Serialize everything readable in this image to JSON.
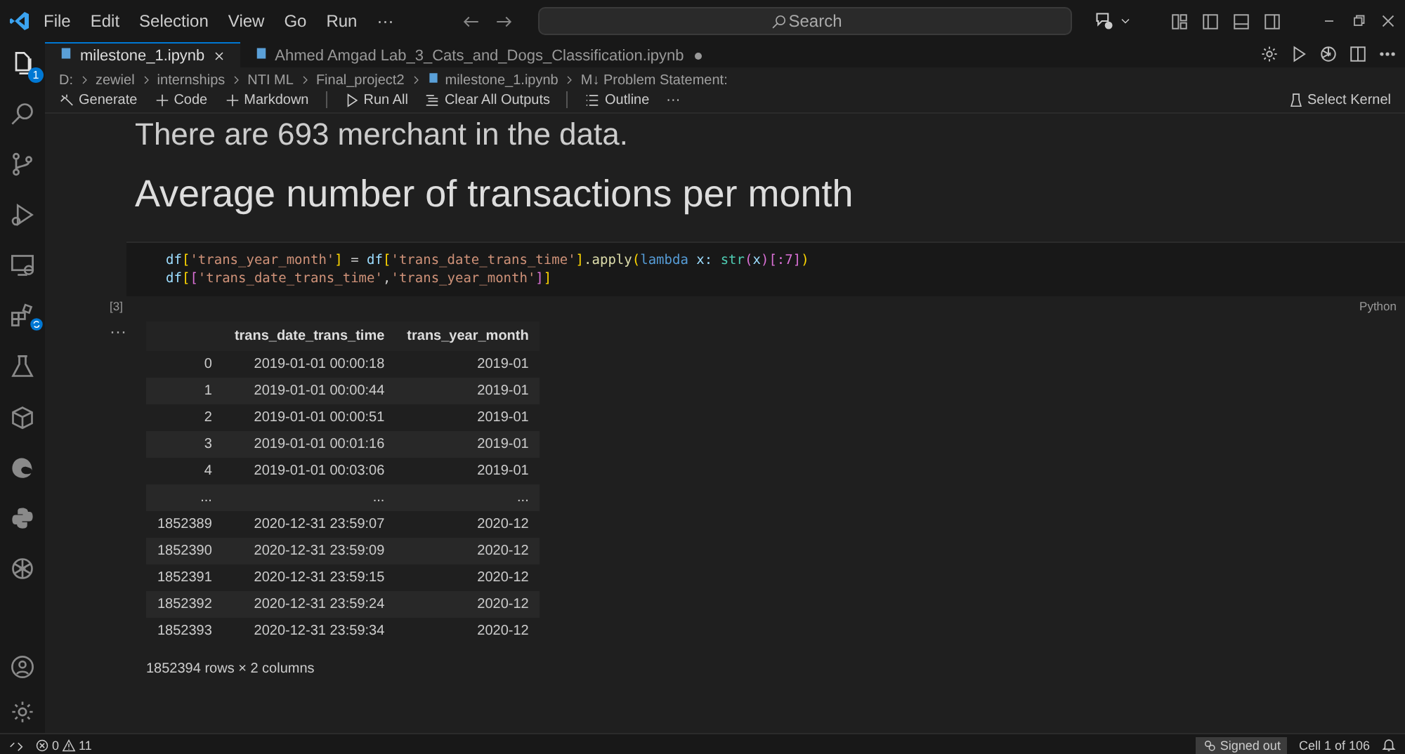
{
  "menu": [
    "File",
    "Edit",
    "Selection",
    "View",
    "Go",
    "Run",
    "···"
  ],
  "search": {
    "placeholder": "Search"
  },
  "activity_bar": {
    "items": [
      {
        "kind": "files",
        "selected": true,
        "badge": "1"
      },
      {
        "kind": "search",
        "selected": false
      },
      {
        "kind": "branch",
        "selected": false
      },
      {
        "kind": "debug",
        "selected": false
      },
      {
        "kind": "remote",
        "selected": false
      },
      {
        "kind": "extensions",
        "selected": false
      },
      {
        "kind": "flask",
        "selected": false
      },
      {
        "kind": "box",
        "selected": false
      },
      {
        "kind": "edge",
        "selected": false
      },
      {
        "kind": "python",
        "selected": false
      },
      {
        "kind": "openai",
        "selected": false
      }
    ]
  },
  "tabs": [
    {
      "label": "milestone_1.ipynb",
      "selected": true,
      "dirty": false
    },
    {
      "label": "Ahmed Amgad Lab_3_Cats_and_Dogs_Classification.ipynb",
      "selected": false,
      "dirty": true
    }
  ],
  "breadcrumb": [
    "D:",
    "zewiel",
    "internships",
    "NTI ML",
    "Final_project2",
    "milestone_1.ipynb",
    "M↓ Problem Statement:"
  ],
  "toolbar": [
    "Generate",
    "Code",
    "Markdown",
    "Run All",
    "Clear All Outputs",
    "Outline",
    "···"
  ],
  "kernel": "Select Kernel",
  "notebook": {
    "prev_text": "There are 693 merchant in the data.",
    "heading": "Average number of transactions per month",
    "cell": {
      "lines": [
        [
          {
            "text": "df",
            "color": "#9cdcfe"
          },
          {
            "text": "[",
            "color": "#ffd700"
          },
          {
            "text": "'trans_year_month'",
            "color": "#ce9178"
          },
          {
            "text": "]",
            "color": "#ffd700"
          },
          {
            "text": " = ",
            "color": "#cccccc"
          },
          {
            "text": "df",
            "color": "#9cdcfe"
          },
          {
            "text": "[",
            "color": "#ffd700"
          },
          {
            "text": "'trans_date_trans_time'",
            "color": "#ce9178"
          },
          {
            "text": "]",
            "color": "#ffd700"
          },
          {
            "text": ".apply",
            "color": "#dcdcaa"
          },
          {
            "text": "(",
            "color": "#ffd700"
          },
          {
            "text": "lambda",
            "color": "#569cd6"
          },
          {
            "text": " x: ",
            "color": "#9cdcfe"
          },
          {
            "text": "str",
            "color": "#4ec9b0"
          },
          {
            "text": "(",
            "color": "#da70d6"
          },
          {
            "text": "x",
            "color": "#9cdcfe"
          },
          {
            "text": ")",
            "color": "#da70d6"
          },
          {
            "text": "[:7]",
            "color": "#da70d6"
          },
          {
            "text": ")",
            "color": "#ffd700"
          }
        ],
        [
          {
            "text": "df",
            "color": "#9cdcfe"
          },
          {
            "text": "[",
            "color": "#ffd700"
          },
          {
            "text": "[",
            "color": "#da70d6"
          },
          {
            "text": "'trans_date_trans_time'",
            "color": "#ce9178"
          },
          {
            "text": ",",
            "color": "#cccccc"
          },
          {
            "text": "'trans_year_month'",
            "color": "#ce9178"
          },
          {
            "text": "]",
            "color": "#da70d6"
          },
          {
            "text": "]",
            "color": "#ffd700"
          }
        ]
      ],
      "count": "[3]",
      "language": "Python"
    },
    "output": {
      "more": "···",
      "columns": [
        "",
        "trans_date_trans_time",
        "trans_year_month"
      ],
      "rows": [
        [
          "0",
          "2019-01-01 00:00:18",
          "2019-01"
        ],
        [
          "1",
          "2019-01-01 00:00:44",
          "2019-01"
        ],
        [
          "2",
          "2019-01-01 00:00:51",
          "2019-01"
        ],
        [
          "3",
          "2019-01-01 00:01:16",
          "2019-01"
        ],
        [
          "4",
          "2019-01-01 00:03:06",
          "2019-01"
        ],
        [
          "...",
          "...",
          "..."
        ],
        [
          "1852389",
          "2020-12-31 23:59:07",
          "2020-12"
        ],
        [
          "1852390",
          "2020-12-31 23:59:09",
          "2020-12"
        ],
        [
          "1852391",
          "2020-12-31 23:59:15",
          "2020-12"
        ],
        [
          "1852392",
          "2020-12-31 23:59:24",
          "2020-12"
        ],
        [
          "1852393",
          "2020-12-31 23:59:34",
          "2020-12"
        ]
      ],
      "summary": "1852394 rows × 2 columns"
    }
  },
  "status_bar": {
    "errors": "0",
    "warnings": "11",
    "account": "Signed out",
    "cell": "Cell 1 of 106"
  }
}
